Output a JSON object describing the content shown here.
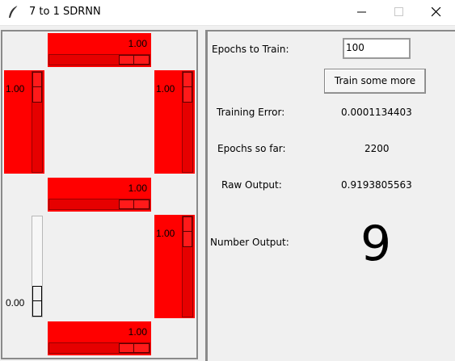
{
  "window": {
    "title": "7 to 1 SDRNN",
    "controls": {
      "minimize_icon": "minimize-icon",
      "maximize_icon": "maximize-icon",
      "close_icon": "close-icon"
    },
    "app_icon": "feather-icon"
  },
  "segments": {
    "top": {
      "value": "1.00",
      "level": 1.0
    },
    "upper_left": {
      "value": "1.00",
      "level": 1.0
    },
    "upper_right": {
      "value": "1.00",
      "level": 1.0
    },
    "middle": {
      "value": "1.00",
      "level": 1.0
    },
    "lower_left": {
      "value": "0.00",
      "level": 0.0
    },
    "lower_right": {
      "value": "1.00",
      "level": 1.0
    },
    "bottom": {
      "value": "1.00",
      "level": 1.0
    }
  },
  "colors": {
    "segment_on": "#ff0000",
    "background": "#f0f0f0"
  },
  "controls": {
    "epochs_label": "Epochs to Train:",
    "epochs_value": "100",
    "train_button": "Train some more"
  },
  "stats": {
    "training_error_label": "Training Error:",
    "training_error_value": "0.0001134403",
    "epochs_so_far_label": "Epochs so far:",
    "epochs_so_far_value": "2200",
    "raw_output_label": "Raw Output:",
    "raw_output_value": "0.9193805563",
    "number_output_label": "Number Output:",
    "number_output_value": "9"
  }
}
